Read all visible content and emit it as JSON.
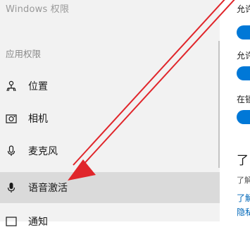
{
  "sidebar": {
    "heading": "Windows 权限",
    "section": "应用权限",
    "items": [
      {
        "label": "位置",
        "icon": "location-icon"
      },
      {
        "label": "相机",
        "icon": "camera-icon"
      },
      {
        "label": "麦克风",
        "icon": "microphone-icon"
      },
      {
        "label": "语音激活",
        "icon": "voice-activation-icon"
      },
      {
        "label": "通知",
        "icon": "notification-icon"
      }
    ]
  },
  "content": {
    "setting1_label": "允许",
    "setting2_label": "允许",
    "setting3_label": "在锁",
    "heading": "了",
    "description": "了解",
    "link1": "了解",
    "link2": "隐私"
  },
  "colors": {
    "accent": "#0078d7",
    "annotation_arrow": "#e0262b",
    "selected_bg": "#dadada",
    "sidebar_bg": "#f2f2f2"
  }
}
